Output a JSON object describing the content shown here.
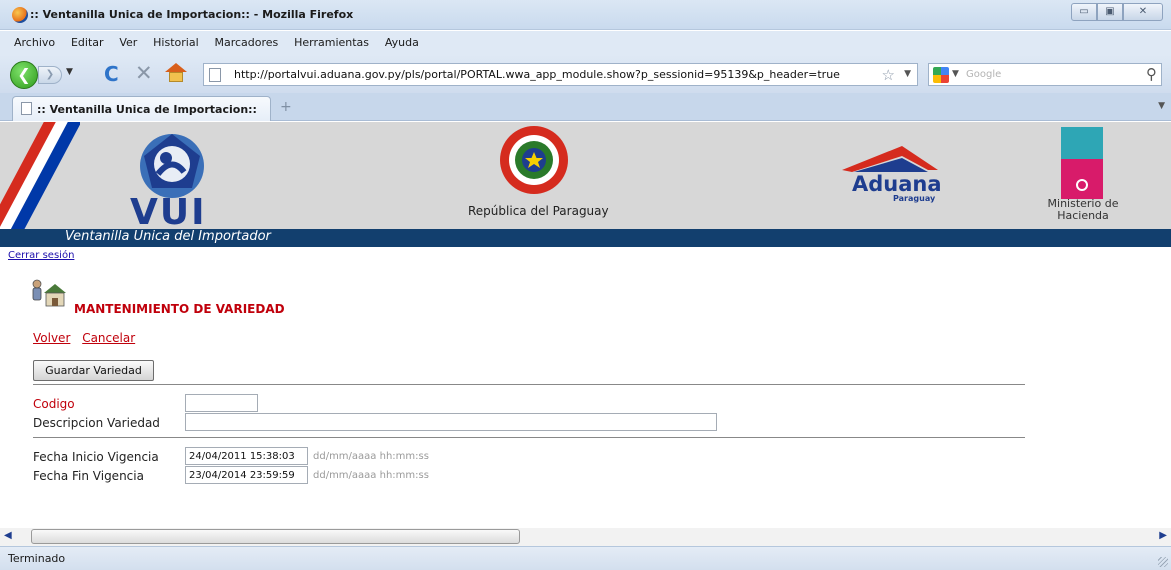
{
  "window": {
    "title": ":: Ventanilla Unica de Importacion:: - Mozilla Firefox",
    "controls": [
      "▭",
      "▣",
      "✕"
    ]
  },
  "menu": [
    "Archivo",
    "Editar",
    "Ver",
    "Historial",
    "Marcadores",
    "Herramientas",
    "Ayuda"
  ],
  "nav": {
    "url": "http://portalvui.aduana.gov.py/pls/portal/PORTAL.wwa_app_module.show?p_sessionid=95139&p_header=true",
    "search_placeholder": "Google"
  },
  "tab": {
    "title": ":: Ventanilla Unica de Importacion::"
  },
  "banner": {
    "vui": "VUI",
    "republica": "República del Paraguay",
    "aduana": "Aduana",
    "paraguay": "Paraguay",
    "ministerio": "Ministerio de Hacienda",
    "subtitle": "Ventanilla Unica del Importador"
  },
  "page": {
    "logout": "Cerrar sesión",
    "title": "MANTENIMIENTO DE VARIEDAD",
    "back": "Volver",
    "cancel": "Cancelar",
    "save_button": "Guardar Variedad"
  },
  "form": {
    "codigo_label": "Codigo",
    "codigo_value": "",
    "descripcion_label": "Descripcion Variedad",
    "descripcion_value": "",
    "inicio_label": "Fecha Inicio Vigencia",
    "inicio_value": "24/04/2011 15:38:03",
    "fin_label": "Fecha Fin Vigencia",
    "fin_value": "23/04/2014 23:59:59",
    "date_format_hint": "dd/mm/aaaa hh:mm:ss"
  },
  "status": "Terminado",
  "colors": {
    "accent_red": "#c0000b",
    "banner_blue": "#123f6e",
    "link_blue": "#1a0dab"
  }
}
